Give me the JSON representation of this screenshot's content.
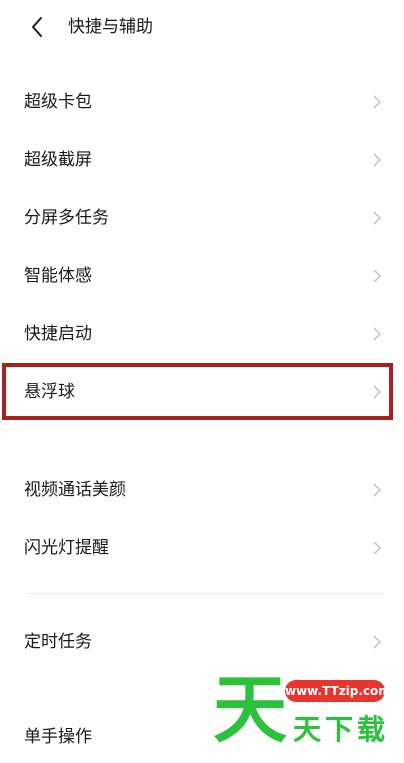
{
  "header": {
    "title": "快捷与辅助",
    "back_icon": "chevron-left-icon"
  },
  "sections": [
    {
      "items": [
        {
          "label": "超级卡包"
        },
        {
          "label": "超级截屏"
        },
        {
          "label": "分屏多任务"
        },
        {
          "label": "智能体感"
        },
        {
          "label": "快捷启动"
        },
        {
          "label": "悬浮球"
        }
      ]
    },
    {
      "items": [
        {
          "label": "视频通话美颜"
        },
        {
          "label": "闪光灯提醒"
        }
      ]
    },
    {
      "items": [
        {
          "label": "定时任务"
        },
        {
          "label": "单手操作"
        }
      ]
    }
  ],
  "row_icon": "chevron-right-icon",
  "highlight": {
    "color": "#a8221f"
  },
  "watermark": {
    "big_char": "天",
    "pill_text": "www.TTzip.com",
    "small_text": "天下载"
  }
}
